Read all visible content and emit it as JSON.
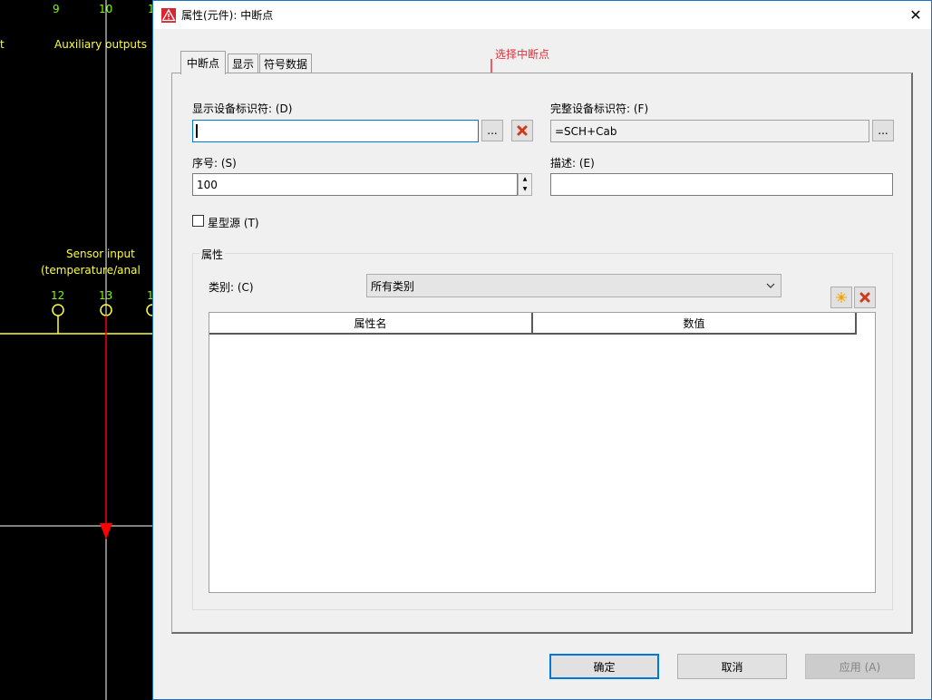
{
  "cad": {
    "top_numbers": [
      "9",
      "10",
      "1"
    ],
    "aux_label": "Auxiliary outputs",
    "t_label": "t",
    "sensor_line1": "Sensor input",
    "sensor_line2": "(temperature/anal",
    "mid_numbers": [
      "12",
      "13",
      "1"
    ]
  },
  "window": {
    "title": "属性(元件): 中断点",
    "close": "✕"
  },
  "tabs": [
    {
      "label": "中断点",
      "active": true
    },
    {
      "label": "显示",
      "active": false
    },
    {
      "label": "符号数据",
      "active": false
    }
  ],
  "annotation": "选择中断点",
  "form": {
    "display_id_label": "显示设备标识符: (D)",
    "display_id_value": "",
    "browse_label": "...",
    "full_id_label": "完整设备标识符: (F)",
    "full_id_value": "=SCH+Cab",
    "full_browse_label": "...",
    "seq_label": "序号: (S)",
    "seq_value": "100",
    "desc_label": "描述: (E)",
    "desc_value": "",
    "star_source_label": "星型源 (T)",
    "star_source_checked": false
  },
  "properties": {
    "group_title": "属性",
    "category_label": "类别: (C)",
    "category_value": "所有类别",
    "columns": [
      "属性名",
      "数值"
    ],
    "rows": []
  },
  "buttons": {
    "ok": "确定",
    "cancel": "取消",
    "apply": "应用 (A)"
  },
  "colors": {
    "accent": "#0078d7",
    "annotation": "#e8303a",
    "cad_green": "#7cfc00",
    "cad_yellow": "#ffff33",
    "cad_red": "#ff0000"
  }
}
